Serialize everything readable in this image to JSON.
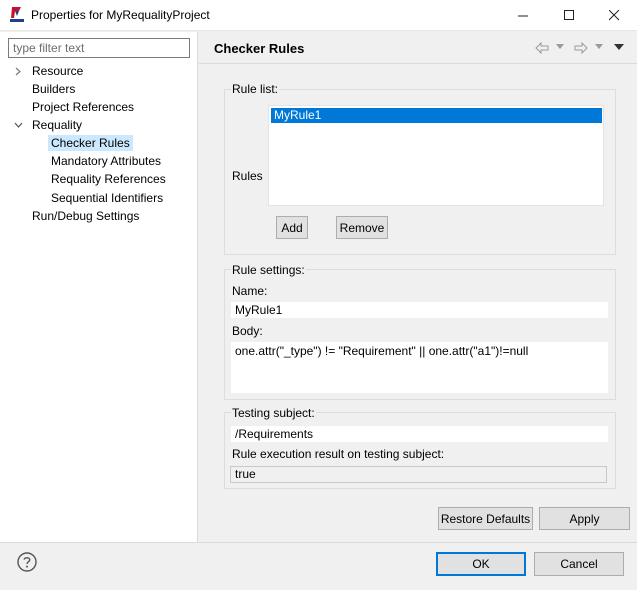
{
  "window": {
    "title": "Properties for MyRequalityProject",
    "icon": "requality-logo-icon"
  },
  "sidebar": {
    "filter_placeholder": "type filter text",
    "items": [
      {
        "label": "Resource",
        "expandable": true,
        "expanded": false
      },
      {
        "label": "Builders"
      },
      {
        "label": "Project References"
      },
      {
        "label": "Requality",
        "expandable": true,
        "expanded": true
      },
      {
        "label": "Checker Rules",
        "selected": true
      },
      {
        "label": "Mandatory Attributes"
      },
      {
        "label": "Requality References"
      },
      {
        "label": "Sequential Identifiers"
      },
      {
        "label": "Run/Debug Settings"
      }
    ]
  },
  "page": {
    "title": "Checker Rules"
  },
  "rule_list": {
    "group_label": "Rule list:",
    "rules_label": "Rules",
    "items": [
      "MyRule1"
    ],
    "selected": "MyRule1",
    "add_label": "Add",
    "remove_label": "Remove"
  },
  "rule_settings": {
    "group_label": "Rule settings:",
    "name_label": "Name:",
    "name_value": "MyRule1",
    "body_label": "Body:",
    "body_value": "one.attr(\"_type\") != \"Requirement\" || one.attr(\"a1\")!=null"
  },
  "testing": {
    "group_label": "Testing subject:",
    "subject_value": "/Requirements",
    "result_label": "Rule execution result on testing subject:",
    "result_value": "true"
  },
  "actions": {
    "restore_label": "Restore Defaults",
    "apply_label": "Apply",
    "ok_label": "OK",
    "cancel_label": "Cancel"
  },
  "colors": {
    "accent": "#0078d7",
    "selection_highlight": "#cce8ff"
  }
}
